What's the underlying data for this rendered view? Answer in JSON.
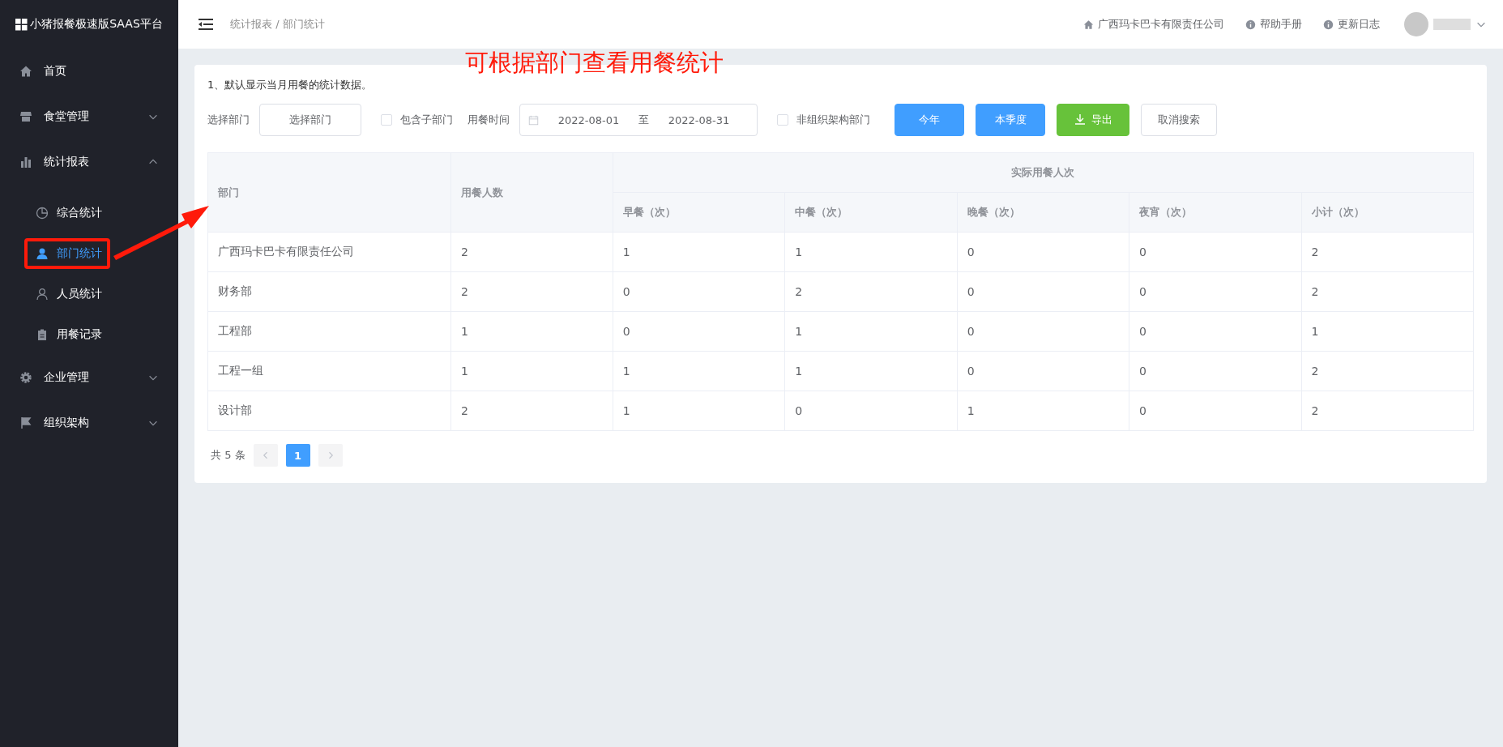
{
  "sidebar": {
    "title": "小猪报餐极速版SAAS平台",
    "items": [
      {
        "label": "首页",
        "kind": "link"
      },
      {
        "label": "食堂管理",
        "kind": "group",
        "expanded": false
      },
      {
        "label": "统计报表",
        "kind": "group",
        "expanded": true,
        "children": [
          {
            "label": "综合统计",
            "selected": false,
            "annotated": false
          },
          {
            "label": "部门统计",
            "selected": true,
            "annotated": true
          },
          {
            "label": "人员统计",
            "selected": false,
            "annotated": false
          },
          {
            "label": "用餐记录",
            "selected": false,
            "annotated": false
          }
        ]
      },
      {
        "label": "企业管理",
        "kind": "group",
        "expanded": false
      },
      {
        "label": "组织架构",
        "kind": "group",
        "expanded": false
      }
    ]
  },
  "header": {
    "breadcrumb": "统计报表 / 部门统计",
    "links": [
      "广西玛卡巴卡有限责任公司",
      "帮助手册",
      "更新日志"
    ]
  },
  "annotation": {
    "text": "可根据部门查看用餐统计"
  },
  "notice": "1、默认显示当月用餐的统计数据。",
  "filters": {
    "department_label": "选择部门",
    "department_button": "选择部门",
    "include_sub": {
      "label": "包含子部门",
      "checked": false
    },
    "time_label": "用餐时间",
    "date_start": "2022-08-01",
    "date_separator": "至",
    "date_end": "2022-08-31",
    "non_org": {
      "label": "非组织架构部门",
      "checked": false
    },
    "buttons": [
      {
        "label": "今年",
        "kind": "primary"
      },
      {
        "label": "本季度",
        "kind": "primary"
      },
      {
        "label": "导出",
        "kind": "success"
      },
      {
        "label": "取消搜索",
        "kind": "default"
      }
    ]
  },
  "table": {
    "columns": [
      "部门",
      "用餐人数"
    ],
    "group_header": "实际用餐人次",
    "sub_columns": [
      "早餐（次）",
      "中餐（次）",
      "晚餐（次）",
      "夜宵（次）",
      "小计（次）"
    ],
    "rows": [
      [
        "广西玛卡巴卡有限责任公司",
        "2",
        "1",
        "1",
        "0",
        "0",
        "2"
      ],
      [
        "财务部",
        "2",
        "0",
        "2",
        "0",
        "0",
        "2"
      ],
      [
        "工程部",
        "1",
        "0",
        "1",
        "0",
        "0",
        "1"
      ],
      [
        "工程一组",
        "1",
        "1",
        "1",
        "0",
        "0",
        "2"
      ],
      [
        "设计部",
        "2",
        "1",
        "0",
        "1",
        "0",
        "2"
      ]
    ]
  },
  "pagination": {
    "total": "共 5 条",
    "pages": [
      {
        "label": "1",
        "selected": true
      }
    ]
  }
}
